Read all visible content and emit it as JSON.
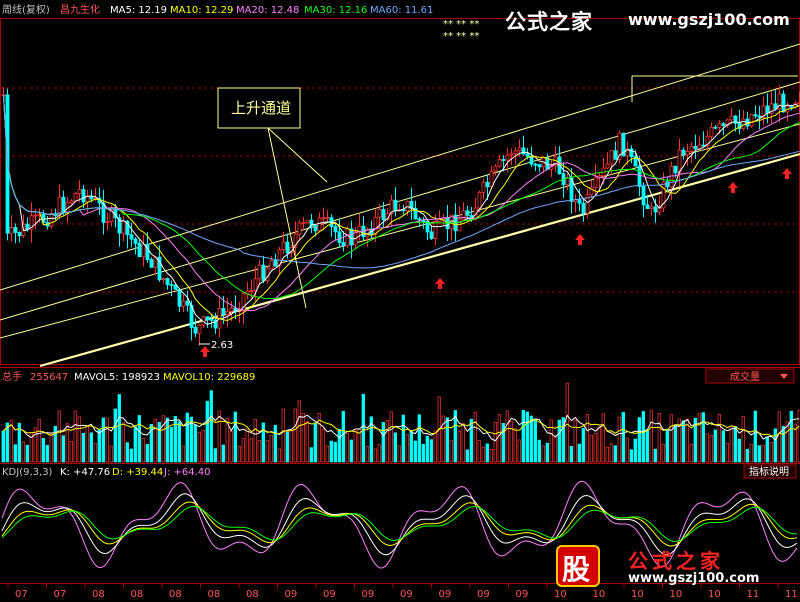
{
  "header": {
    "period_label": "周线(复权)",
    "stock_name": "昌九生化",
    "ma": [
      {
        "label": "MA5: 12.19",
        "color": "#ffffff"
      },
      {
        "label": "MA10: 12.29",
        "color": "#ffff00"
      },
      {
        "label": "MA20: 12.48",
        "color": "#ff80ff"
      },
      {
        "label": "MA30: 12.16",
        "color": "#00ff00"
      },
      {
        "label": "MA60: 11.61",
        "color": "#6ea9ff"
      }
    ],
    "star_rows": [
      "** ** **",
      "** ** **"
    ]
  },
  "watermark": {
    "brand": "公式之家",
    "url": "www.gszj100.com",
    "stock_char": "股"
  },
  "annotation": {
    "channel_label": "上升通道",
    "low_price": "2.63"
  },
  "volume_panel": {
    "total_label": "总手",
    "total_value": "255647",
    "mavol5": "MAVOL5: 198923",
    "mavol10": "MAVOL10: 229689",
    "dropdown_label": "成交量"
  },
  "kdj_panel": {
    "title": "KDJ(9,3,3)",
    "k": "K: +47.76",
    "d": "D: +39.44",
    "j": "J: +64.40",
    "help_label": "指标说明"
  },
  "x_axis": {
    "ticks": [
      "07",
      "07",
      "08",
      "08",
      "08",
      "08",
      "08",
      "09",
      "09",
      "09",
      "09",
      "09",
      "09",
      "09",
      "10",
      "10",
      "10",
      "10",
      "10",
      "11",
      "11"
    ]
  },
  "colors": {
    "up": "#ff3333",
    "down": "#00ffff",
    "channel": "#ffff99",
    "dashed_grid": "#990000",
    "panel_border": "#aa0000"
  },
  "chart_data": {
    "type": "candlestick",
    "price_channel": {
      "lower_anchor_low": 2.63,
      "labels": [
        "上升通道"
      ]
    },
    "ma_latest": {
      "MA5": 12.19,
      "MA10": 12.29,
      "MA20": 12.48,
      "MA30": 12.16,
      "MA60": 11.61
    },
    "volume_latest": {
      "total": 255647,
      "MAVOL5": 198923,
      "MAVOL10": 229689
    },
    "kdj_latest": {
      "K": 47.76,
      "D": 39.44,
      "J": 64.4
    },
    "support_arrows_count": 5
  }
}
